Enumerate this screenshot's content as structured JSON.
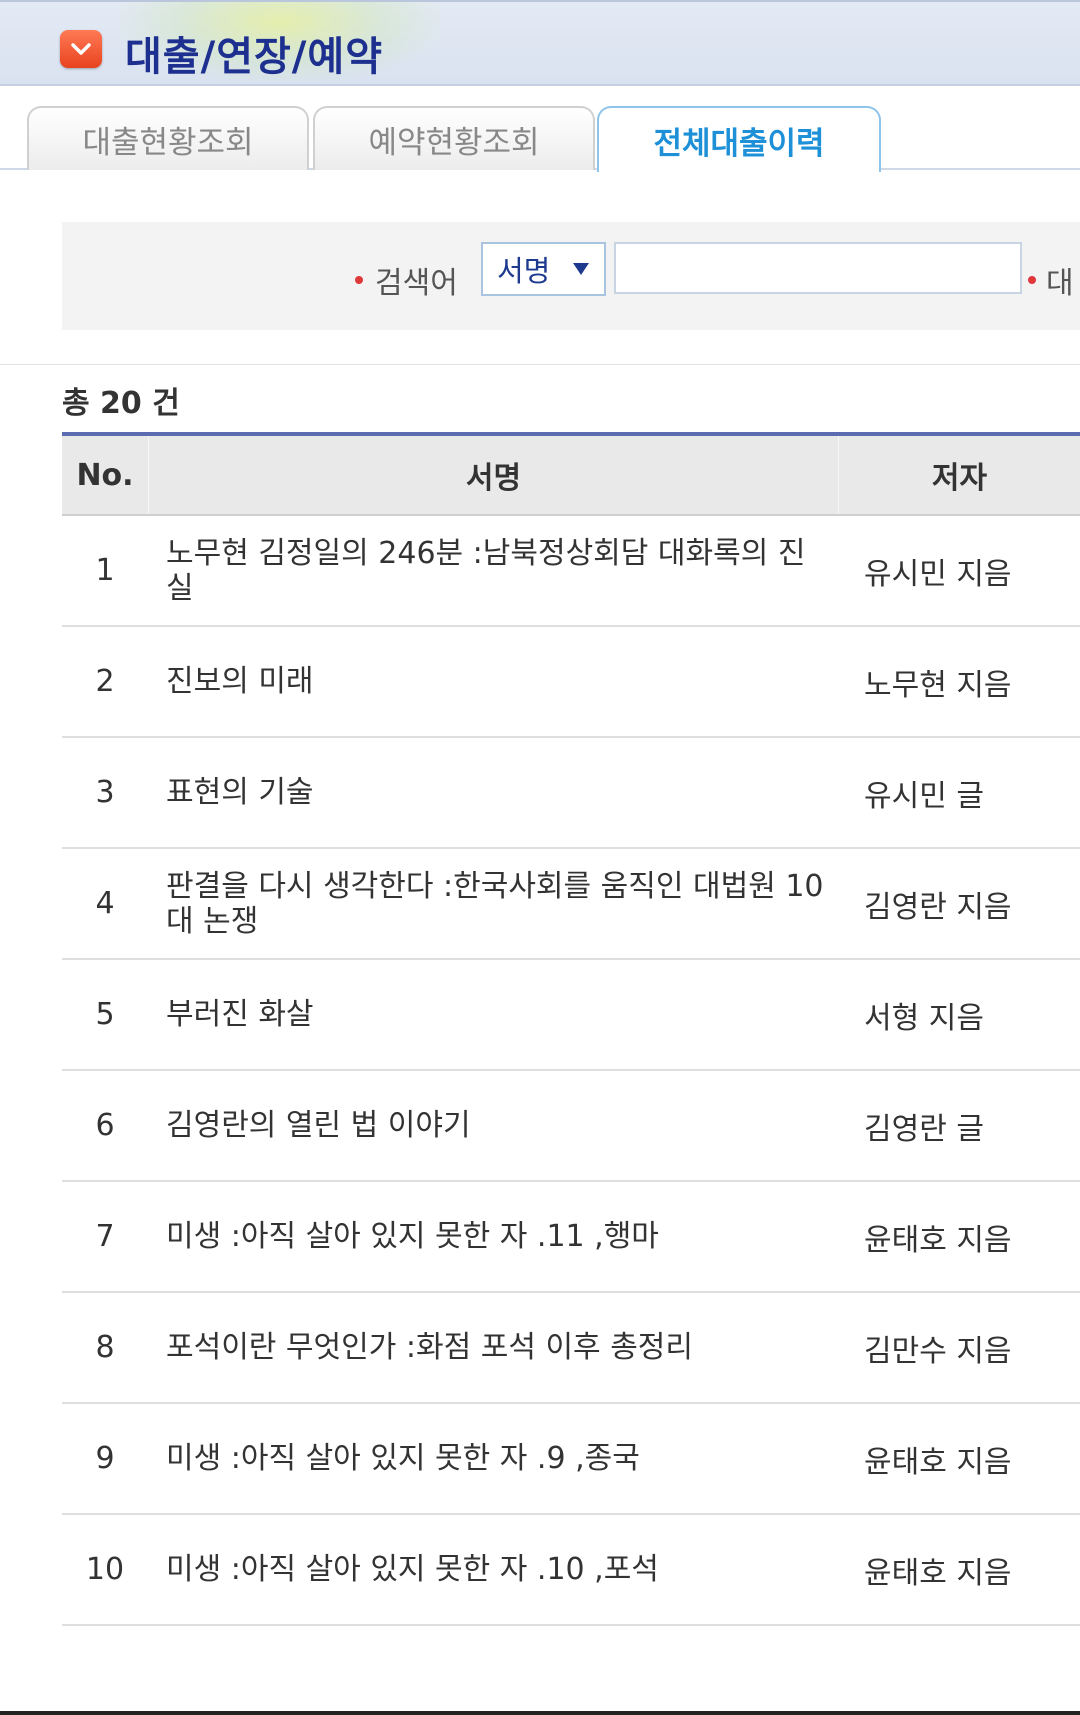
{
  "header": {
    "title": "대출/연장/예약",
    "menu_icon": "chevron-down-icon",
    "button_color": "#f05a35"
  },
  "tabs": [
    {
      "label": "대출현황조회",
      "active": false
    },
    {
      "label": "예약현황조회",
      "active": false
    },
    {
      "label": "전체대출이력",
      "active": true
    }
  ],
  "search": {
    "label": "검색어",
    "select_value": "서명",
    "select_icon": "triangle-down-icon",
    "input_value": "",
    "label2": "대"
  },
  "total": "총 20 건",
  "table": {
    "headers": {
      "no": "No.",
      "title": "서명",
      "author": "저자"
    },
    "rows": [
      {
        "no": "1",
        "title": "노무현 김정일의 246분 :남북정상회담 대화록의 진실",
        "author": "유시민 지음"
      },
      {
        "no": "2",
        "title": "진보의 미래",
        "author": "노무현 지음"
      },
      {
        "no": "3",
        "title": "표현의 기술",
        "author": "유시민 글"
      },
      {
        "no": "4",
        "title": "판결을 다시 생각한다 :한국사회를 움직인 대법원 10대 논쟁",
        "author": "김영란 지음"
      },
      {
        "no": "5",
        "title": "부러진 화살",
        "author": "서형 지음"
      },
      {
        "no": "6",
        "title": "김영란의 열린 법 이야기",
        "author": "김영란 글"
      },
      {
        "no": "7",
        "title": "미생 :아직 살아 있지 못한 자 .11 ,행마",
        "author": "윤태호 지음"
      },
      {
        "no": "8",
        "title": "포석이란 무엇인가 :화점 포석 이후 총정리",
        "author": "김만수 지음"
      },
      {
        "no": "9",
        "title": "미생 :아직 살아 있지 못한 자 .9 ,종국",
        "author": "윤태호 지음"
      },
      {
        "no": "10",
        "title": "미생 :아직 살아 있지 못한 자 .10 ,포석",
        "author": "윤태호 지음"
      }
    ]
  },
  "colors": {
    "title_text": "#1d2f8f",
    "active_tab": "#1e90d8",
    "table_top_border": "#5c6cb0",
    "bullet": "#e0383a"
  }
}
